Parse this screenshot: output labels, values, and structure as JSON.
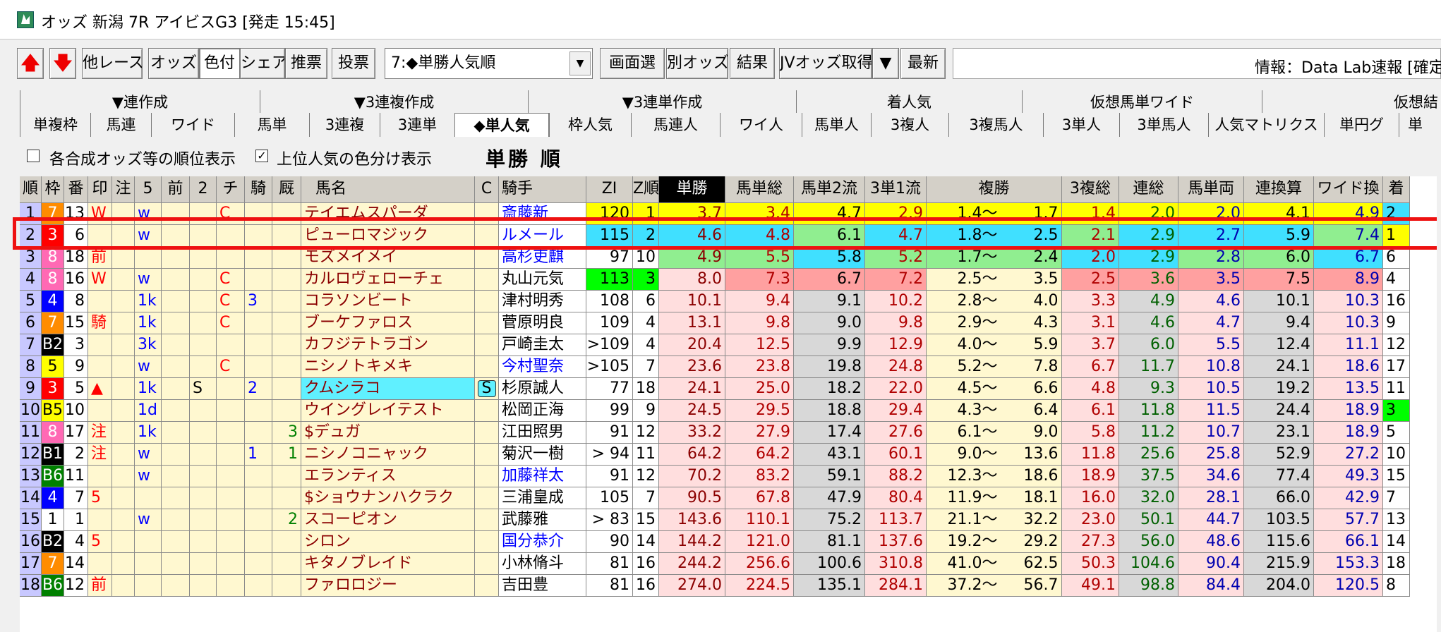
{
  "window": {
    "title": "オッズ 新潟 7R アイビスG3 [発走 15:45]",
    "app_icon": "racehorse-app-icon"
  },
  "toolbar": {
    "up_arrow": "🡅",
    "down_arrow": "🡇",
    "other_race": "他レース",
    "odds": "オッズ",
    "color": "色付",
    "share": "シェア",
    "recommend": "推票",
    "vote": "投票",
    "dropdown_value": "7:◆単勝人気順",
    "dropdown_icon": "chevron-down-icon",
    "screen_select": "画面選",
    "other_odds": "別オッズ",
    "result": "結果",
    "jv_odds": "JVオッズ取得",
    "jv_arrow": "▼",
    "latest": "最新",
    "info": "情報：Data Lab速報 [確定"
  },
  "tab_groups": [
    "▼連作成",
    "▼3連複作成",
    "▼3連単作成",
    "着人気",
    "仮想馬単ワイド",
    "仮想結"
  ],
  "tabs": [
    "単複枠",
    "馬連",
    "ワイド",
    "馬単",
    "3連複",
    "3連単",
    "◆単人気",
    "枠人気",
    "馬連人",
    "ワイ人",
    "馬単人",
    "3複人",
    "3複馬人",
    "3単人",
    "3単馬人",
    "人気マトリクス",
    "単円グ",
    "単"
  ],
  "active_tab": "◆単人気",
  "options": {
    "rank_display_label": "各合成オッズ等の順位表示",
    "rank_display_checked": false,
    "color_top_label": "上位人気の色分け表示",
    "color_top_checked": true,
    "check_mark": "✓"
  },
  "grid_title": "単勝 順",
  "columns": [
    "順",
    "枠",
    "番",
    "印",
    "注",
    "5",
    "前",
    "2",
    "チ",
    "騎",
    "厩",
    "馬名",
    "C",
    "騎手",
    "ZI",
    "Z順",
    "単勝",
    "馬単総",
    "馬単2流",
    "3単1流",
    "複勝",
    "3複総",
    "連総",
    "馬単両",
    "連換算",
    "ワイド換",
    "着"
  ],
  "colors": {
    "waku": {
      "1": "#ffffff",
      "2": "#000000",
      "3": "#ff0000",
      "4": "#0000ff",
      "5": "#ffff00",
      "6": "#008000",
      "7": "#ff8c00",
      "8": "#ff69b4"
    },
    "rank1": "#ffff00",
    "rank2": "#40e0ff",
    "rank3": "#90ee90",
    "rank4": "#ffa0a0",
    "pink": "#ffdede",
    "gray": "#d8d8d8",
    "lime": "#00ff00"
  },
  "rows": [
    {
      "rank": "1",
      "waku": "7",
      "umaban": "13",
      "mark": "W",
      "note": "",
      "five": "w",
      "mae": "",
      "two": "",
      "chi": "C",
      "ki": "",
      "kyu": "",
      "name": "テイエムスパーダ",
      "c": "",
      "jockey": "斎藤新",
      "zi": "120",
      "zrank": "1",
      "tansho": "3.7",
      "umatan_sou": "3.4",
      "umatan_2ryu": "4.7",
      "santan_1ryu": "2.9",
      "fukusho_lo": "1.4～",
      "fukusho_hi": "1.7",
      "sanpuku_sou": "1.4",
      "rensou": "2.0",
      "umatan_ryo": "2.0",
      "renkansan": "4.1",
      "wide_kan": "4.9",
      "chaku": "2"
    },
    {
      "rank": "2",
      "waku": "3",
      "umaban": "6",
      "mark": "",
      "note": "",
      "five": "w",
      "mae": "",
      "two": "",
      "chi": "",
      "ki": "",
      "kyu": "",
      "name": "ピューロマジック",
      "c": "",
      "jockey": "ルメール",
      "zi": "115",
      "zrank": "2",
      "tansho": "4.6",
      "umatan_sou": "4.8",
      "umatan_2ryu": "6.1",
      "santan_1ryu": "4.7",
      "fukusho_lo": "1.8～",
      "fukusho_hi": "2.5",
      "sanpuku_sou": "2.1",
      "rensou": "2.9",
      "umatan_ryo": "2.7",
      "renkansan": "5.9",
      "wide_kan": "7.4",
      "chaku": "1"
    },
    {
      "rank": "3",
      "waku": "8",
      "umaban": "18",
      "mark": "前",
      "note": "",
      "five": "",
      "mae": "",
      "two": "",
      "chi": "",
      "ki": "",
      "kyu": "",
      "name": "モズメイメイ",
      "c": "",
      "jockey": "高杉吏麒",
      "zi": "97",
      "zrank": "10",
      "tansho": "4.9",
      "umatan_sou": "5.5",
      "umatan_2ryu": "5.8",
      "santan_1ryu": "5.2",
      "fukusho_lo": "1.7～",
      "fukusho_hi": "2.4",
      "sanpuku_sou": "2.0",
      "rensou": "2.9",
      "umatan_ryo": "2.8",
      "renkansan": "6.0",
      "wide_kan": "6.7",
      "chaku": "6"
    },
    {
      "rank": "4",
      "waku": "8",
      "umaban": "16",
      "mark": "W",
      "note": "",
      "five": "w",
      "mae": "",
      "two": "",
      "chi": "C",
      "ki": "",
      "kyu": "",
      "name": "カルロヴェローチェ",
      "c": "",
      "jockey": "丸山元気",
      "zi": "113",
      "zrank": "3",
      "tansho": "8.0",
      "umatan_sou": "7.3",
      "umatan_2ryu": "6.7",
      "santan_1ryu": "7.2",
      "fukusho_lo": "2.5～",
      "fukusho_hi": "3.5",
      "sanpuku_sou": "2.5",
      "rensou": "3.6",
      "umatan_ryo": "3.5",
      "renkansan": "7.5",
      "wide_kan": "8.9",
      "chaku": "4"
    },
    {
      "rank": "5",
      "waku": "4",
      "umaban": "8",
      "mark": "",
      "note": "",
      "five": "1k",
      "mae": "",
      "two": "",
      "chi": "C",
      "ki": "3",
      "kyu": "",
      "name": "コラソンビート",
      "c": "",
      "jockey": "津村明秀",
      "zi": "108",
      "zrank": "6",
      "tansho": "10.1",
      "umatan_sou": "9.4",
      "umatan_2ryu": "9.1",
      "santan_1ryu": "10.2",
      "fukusho_lo": "2.8～",
      "fukusho_hi": "4.0",
      "sanpuku_sou": "3.3",
      "rensou": "4.9",
      "umatan_ryo": "4.6",
      "renkansan": "10.1",
      "wide_kan": "10.3",
      "chaku": "16"
    },
    {
      "rank": "6",
      "waku": "7",
      "umaban": "15",
      "mark": "騎",
      "note": "",
      "five": "1k",
      "mae": "",
      "two": "",
      "chi": "C",
      "ki": "",
      "kyu": "",
      "name": "ブーケファロス",
      "c": "",
      "jockey": "菅原明良",
      "zi": "109",
      "zrank": "4",
      "tansho": "13.1",
      "umatan_sou": "9.8",
      "umatan_2ryu": "9.0",
      "santan_1ryu": "9.8",
      "fukusho_lo": "2.9～",
      "fukusho_hi": "4.3",
      "sanpuku_sou": "3.1",
      "rensou": "4.6",
      "umatan_ryo": "4.7",
      "renkansan": "9.4",
      "wide_kan": "10.3",
      "chaku": "9"
    },
    {
      "rank": "7",
      "waku": "B2",
      "umaban": "3",
      "mark": "",
      "note": "",
      "five": "3k",
      "mae": "",
      "two": "",
      "chi": "",
      "ki": "",
      "kyu": "",
      "name": "カフジテトラゴン",
      "c": "",
      "jockey": "戸崎圭太",
      "zi": ">109",
      "zrank": "4",
      "tansho": "20.4",
      "umatan_sou": "12.5",
      "umatan_2ryu": "9.9",
      "santan_1ryu": "12.9",
      "fukusho_lo": "4.0～",
      "fukusho_hi": "5.9",
      "sanpuku_sou": "3.7",
      "rensou": "6.0",
      "umatan_ryo": "5.5",
      "renkansan": "12.4",
      "wide_kan": "11.1",
      "chaku": "12"
    },
    {
      "rank": "8",
      "waku": "5",
      "umaban": "9",
      "mark": "",
      "note": "",
      "five": "w",
      "mae": "",
      "two": "",
      "chi": "C",
      "ki": "",
      "kyu": "",
      "name": "ニシノトキメキ",
      "c": "",
      "jockey": "今村聖奈",
      "zi": ">105",
      "zrank": "7",
      "tansho": "23.6",
      "umatan_sou": "23.8",
      "umatan_2ryu": "19.8",
      "santan_1ryu": "24.8",
      "fukusho_lo": "5.2～",
      "fukusho_hi": "7.8",
      "sanpuku_sou": "6.7",
      "rensou": "11.7",
      "umatan_ryo": "10.8",
      "renkansan": "24.1",
      "wide_kan": "18.6",
      "chaku": "17"
    },
    {
      "rank": "9",
      "waku": "3",
      "umaban": "5",
      "mark": "▲",
      "note": "",
      "five": "1k",
      "mae": "",
      "two": "S",
      "chi": "",
      "ki": "2",
      "kyu": "",
      "name": "クムシラコ",
      "c": "S",
      "jockey": "杉原誠人",
      "zi": "77",
      "zrank": "18",
      "tansho": "24.1",
      "umatan_sou": "25.0",
      "umatan_2ryu": "18.2",
      "santan_1ryu": "22.0",
      "fukusho_lo": "4.5～",
      "fukusho_hi": "6.6",
      "sanpuku_sou": "4.8",
      "rensou": "9.3",
      "umatan_ryo": "10.5",
      "renkansan": "19.2",
      "wide_kan": "13.5",
      "chaku": "11"
    },
    {
      "rank": "10",
      "waku": "B5",
      "umaban": "10",
      "mark": "",
      "note": "",
      "five": "1d",
      "mae": "",
      "two": "",
      "chi": "",
      "ki": "",
      "kyu": "",
      "name": "ウイングレイテスト",
      "c": "",
      "jockey": "松岡正海",
      "zi": "99",
      "zrank": "9",
      "tansho": "24.5",
      "umatan_sou": "29.5",
      "umatan_2ryu": "18.8",
      "santan_1ryu": "29.4",
      "fukusho_lo": "4.3～",
      "fukusho_hi": "6.4",
      "sanpuku_sou": "6.1",
      "rensou": "11.8",
      "umatan_ryo": "11.5",
      "renkansan": "24.4",
      "wide_kan": "18.9",
      "chaku": "3"
    },
    {
      "rank": "11",
      "waku": "8",
      "umaban": "17",
      "mark": "注",
      "note": "",
      "five": "1k",
      "mae": "",
      "two": "",
      "chi": "",
      "ki": "",
      "kyu": "3",
      "name": "$デュガ",
      "c": "",
      "jockey": "江田照男",
      "zi": "91",
      "zrank": "12",
      "tansho": "33.2",
      "umatan_sou": "27.9",
      "umatan_2ryu": "17.4",
      "santan_1ryu": "27.6",
      "fukusho_lo": "6.1～",
      "fukusho_hi": "9.0",
      "sanpuku_sou": "5.8",
      "rensou": "11.2",
      "umatan_ryo": "10.7",
      "renkansan": "23.1",
      "wide_kan": "18.9",
      "chaku": "5"
    },
    {
      "rank": "12",
      "waku": "B1",
      "umaban": "2",
      "mark": "注",
      "note": "",
      "five": "w",
      "mae": "",
      "two": "",
      "chi": "",
      "ki": "1",
      "kyu": "1",
      "name": "ニシノコニャック",
      "c": "",
      "jockey": "菊沢一樹",
      "zi": "> 94",
      "zrank": "11",
      "tansho": "64.2",
      "umatan_sou": "64.2",
      "umatan_2ryu": "43.1",
      "santan_1ryu": "60.1",
      "fukusho_lo": "9.0～",
      "fukusho_hi": "13.6",
      "sanpuku_sou": "11.8",
      "rensou": "25.6",
      "umatan_ryo": "25.8",
      "renkansan": "52.9",
      "wide_kan": "27.2",
      "chaku": "10"
    },
    {
      "rank": "13",
      "waku": "B6",
      "umaban": "11",
      "mark": "",
      "note": "",
      "five": "w",
      "mae": "",
      "two": "",
      "chi": "",
      "ki": "",
      "kyu": "",
      "name": "エランティス",
      "c": "",
      "jockey": "加藤祥太",
      "zi": "91",
      "zrank": "12",
      "tansho": "70.2",
      "umatan_sou": "83.2",
      "umatan_2ryu": "59.1",
      "santan_1ryu": "88.2",
      "fukusho_lo": "12.3～",
      "fukusho_hi": "18.6",
      "sanpuku_sou": "18.9",
      "rensou": "37.5",
      "umatan_ryo": "34.6",
      "renkansan": "77.4",
      "wide_kan": "49.3",
      "chaku": "15"
    },
    {
      "rank": "14",
      "waku": "4",
      "umaban": "7",
      "mark": "5",
      "note": "",
      "five": "",
      "mae": "",
      "two": "",
      "chi": "",
      "ki": "",
      "kyu": "",
      "name": "$ショウナンハクラク",
      "c": "",
      "jockey": "三浦皇成",
      "zi": "105",
      "zrank": "7",
      "tansho": "90.5",
      "umatan_sou": "67.8",
      "umatan_2ryu": "47.9",
      "santan_1ryu": "80.4",
      "fukusho_lo": "11.9～",
      "fukusho_hi": "18.1",
      "sanpuku_sou": "16.0",
      "rensou": "32.0",
      "umatan_ryo": "28.1",
      "renkansan": "66.0",
      "wide_kan": "42.9",
      "chaku": "7"
    },
    {
      "rank": "15",
      "waku": "1",
      "umaban": "1",
      "mark": "",
      "note": "",
      "five": "w",
      "mae": "",
      "two": "",
      "chi": "",
      "ki": "",
      "kyu": "2",
      "name": "スコーピオン",
      "c": "",
      "jockey": "武藤雅",
      "zi": "> 83",
      "zrank": "15",
      "tansho": "143.6",
      "umatan_sou": "110.1",
      "umatan_2ryu": "75.2",
      "santan_1ryu": "113.7",
      "fukusho_lo": "21.1～",
      "fukusho_hi": "32.2",
      "sanpuku_sou": "23.0",
      "rensou": "50.1",
      "umatan_ryo": "44.7",
      "renkansan": "103.5",
      "wide_kan": "57.7",
      "chaku": "13"
    },
    {
      "rank": "16",
      "waku": "B2",
      "umaban": "4",
      "mark": "5",
      "note": "",
      "five": "",
      "mae": "",
      "two": "",
      "chi": "",
      "ki": "",
      "kyu": "",
      "name": "シロン",
      "c": "",
      "jockey": "国分恭介",
      "zi": "90",
      "zrank": "14",
      "tansho": "144.2",
      "umatan_sou": "121.0",
      "umatan_2ryu": "81.1",
      "santan_1ryu": "137.6",
      "fukusho_lo": "19.2～",
      "fukusho_hi": "29.2",
      "sanpuku_sou": "27.3",
      "rensou": "56.0",
      "umatan_ryo": "48.6",
      "renkansan": "115.6",
      "wide_kan": "66.1",
      "chaku": "14"
    },
    {
      "rank": "17",
      "waku": "7",
      "umaban": "14",
      "mark": "",
      "note": "",
      "five": "",
      "mae": "",
      "two": "",
      "chi": "",
      "ki": "",
      "kyu": "",
      "name": "キタノブレイド",
      "c": "",
      "jockey": "小林脩斗",
      "zi": "81",
      "zrank": "16",
      "tansho": "244.2",
      "umatan_sou": "256.6",
      "umatan_2ryu": "100.6",
      "santan_1ryu": "310.8",
      "fukusho_lo": "41.0～",
      "fukusho_hi": "62.5",
      "sanpuku_sou": "50.3",
      "rensou": "104.6",
      "umatan_ryo": "90.4",
      "renkansan": "215.9",
      "wide_kan": "153.3",
      "chaku": "18"
    },
    {
      "rank": "18",
      "waku": "B6",
      "umaban": "12",
      "mark": "前",
      "note": "",
      "five": "",
      "mae": "",
      "two": "",
      "chi": "",
      "ki": "",
      "kyu": "",
      "name": "ファロロジー",
      "c": "",
      "jockey": "吉田豊",
      "zi": "81",
      "zrank": "16",
      "tansho": "274.0",
      "umatan_sou": "224.5",
      "umatan_2ryu": "135.1",
      "santan_1ryu": "284.1",
      "fukusho_lo": "37.2～",
      "fukusho_hi": "56.7",
      "sanpuku_sou": "49.1",
      "rensou": "98.8",
      "umatan_ryo": "84.4",
      "renkansan": "204.0",
      "wide_kan": "120.5",
      "chaku": "8"
    }
  ],
  "highlighted_row": "2"
}
